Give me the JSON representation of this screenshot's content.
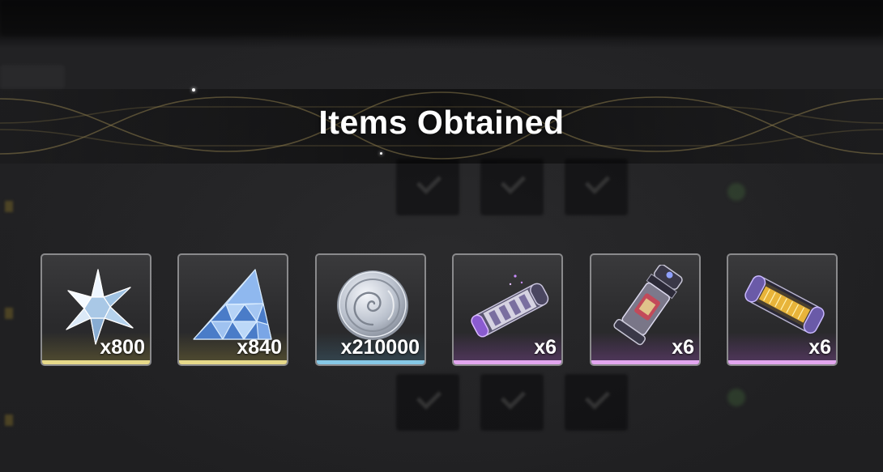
{
  "title": "Items Obtained",
  "items": [
    {
      "name": "star-crystal",
      "icon": "star-crystal-icon",
      "count": "x800",
      "rarity": "gold",
      "rarity_color": "#e6d98a"
    },
    {
      "name": "triangle-crystal",
      "icon": "triangle-crystal-icon",
      "count": "x840",
      "rarity": "gold",
      "rarity_color": "#e6d98a"
    },
    {
      "name": "silver-coin",
      "icon": "silver-coin-icon",
      "count": "x210000",
      "rarity": "blue",
      "rarity_color": "#86c8e6"
    },
    {
      "name": "purple-cylinder",
      "icon": "purple-cylinder-icon",
      "count": "x6",
      "rarity": "purple",
      "rarity_color": "#e2a6ef"
    },
    {
      "name": "vial-canister",
      "icon": "vial-canister-icon",
      "count": "x6",
      "rarity": "purple",
      "rarity_color": "#e2a6ef"
    },
    {
      "name": "gold-capsule",
      "icon": "gold-capsule-icon",
      "count": "x6",
      "rarity": "purple",
      "rarity_color": "#e2a6ef"
    }
  ]
}
